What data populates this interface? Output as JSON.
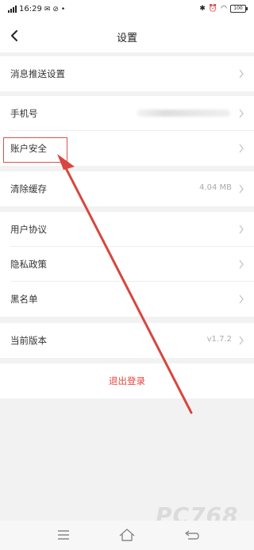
{
  "status_bar": {
    "time": "16:29",
    "battery": "100"
  },
  "header": {
    "title": "设置"
  },
  "settings": {
    "push": "消息推送设置",
    "phone": "手机号",
    "account_security": "账户安全",
    "clear_cache": "清除缓存",
    "cache_size": "4.04 MB",
    "user_agreement": "用户协议",
    "privacy_policy": "隐私政策",
    "blacklist": "黑名单",
    "current_version": "当前版本",
    "version": "v1.7.2"
  },
  "logout": {
    "label": "退出登录"
  },
  "watermark": "PC768",
  "colors": {
    "accent": "#e0463f",
    "arrow": "#d8463e",
    "background": "#f2f2f2"
  },
  "icons": [
    "back-arrow-icon",
    "chevron-right-icon",
    "menu-icon",
    "home-icon",
    "return-icon",
    "signal-icon",
    "wifi-icon",
    "bluetooth-icon",
    "battery-icon"
  ]
}
